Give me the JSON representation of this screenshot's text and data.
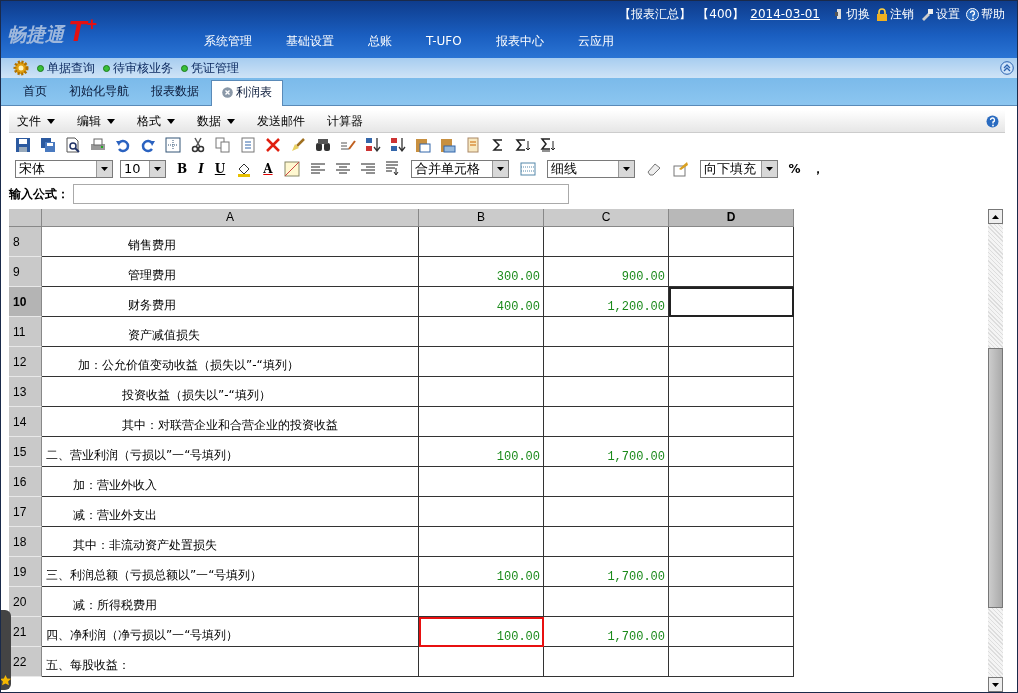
{
  "header": {
    "logo": "畅捷通",
    "logo_mark": "T",
    "logo_plus": "+",
    "status": [
      "【报表汇总】",
      "【400】"
    ],
    "date": "2014-03-01",
    "actions": [
      {
        "label": "切换",
        "kind": "switch"
      },
      {
        "label": "注销",
        "kind": "lock"
      },
      {
        "label": "设置",
        "kind": "settings"
      },
      {
        "label": "帮助",
        "kind": "help"
      }
    ],
    "nav": [
      "系统管理",
      "基础设置",
      "总账",
      "T-UFO",
      "报表中心",
      "云应用"
    ]
  },
  "quickbar": [
    "单据查询",
    "待审核业务",
    "凭证管理"
  ],
  "tabs": [
    {
      "label": "首页",
      "selected": false,
      "closable": false
    },
    {
      "label": "初始化导航",
      "selected": false,
      "closable": false
    },
    {
      "label": "报表数据",
      "selected": false,
      "closable": false
    },
    {
      "label": "利润表",
      "selected": true,
      "closable": true
    }
  ],
  "menu": [
    {
      "label": "文件",
      "dropdown": true
    },
    {
      "label": "编辑",
      "dropdown": true
    },
    {
      "label": "格式",
      "dropdown": true
    },
    {
      "label": "数据",
      "dropdown": true
    },
    {
      "label": "发送邮件",
      "dropdown": false
    },
    {
      "label": "计算器",
      "dropdown": false
    }
  ],
  "format_bar": {
    "font": "宋体",
    "size": "10",
    "bold": "B",
    "italic": "I",
    "underline": "U",
    "font_color": "A",
    "merge": "合并单元格",
    "border": "细线",
    "fill": "向下填充",
    "percent": "%",
    "comma": "，"
  },
  "formula": {
    "label": "输入公式："
  },
  "grid": {
    "columns": [
      "A",
      "B",
      "C",
      "D"
    ],
    "rows": [
      {
        "num": "8",
        "kind": "level3",
        "label": "销售费用",
        "current": false,
        "selected_d": false,
        "flagged_b": false
      },
      {
        "num": "9",
        "kind": "level3",
        "label": "管理费用",
        "b": "300.00",
        "c": "900.00",
        "current": false,
        "selected_d": false,
        "flagged_b": false
      },
      {
        "num": "10",
        "kind": "level3",
        "label": "财务费用",
        "b": "400.00",
        "c": "1,200.00",
        "current": true,
        "selected_d": true,
        "flagged_b": false
      },
      {
        "num": "11",
        "kind": "level3",
        "label": "资产减值损失",
        "current": false,
        "selected_d": false,
        "flagged_b": false
      },
      {
        "num": "12",
        "kind": "level2",
        "label": "加：公允价值变动收益（损失以”-“填列）",
        "current": false,
        "selected_d": false,
        "flagged_b": false
      },
      {
        "num": "13",
        "kind": "level3b",
        "label": "投资收益（损失以”-“填列）",
        "current": false,
        "selected_d": false,
        "flagged_b": false
      },
      {
        "num": "14",
        "kind": "level3b",
        "label": "其中：对联营企业和合营企业的投资收益",
        "current": false,
        "selected_d": false,
        "flagged_b": false
      },
      {
        "num": "15",
        "kind": "level1",
        "label": "二、营业利润（亏损以”一“号填列）",
        "b": "100.00",
        "c": "1,700.00",
        "current": false,
        "selected_d": false,
        "flagged_b": false
      },
      {
        "num": "16",
        "kind": "level2b",
        "label": "加：营业外收入",
        "current": false,
        "selected_d": false,
        "flagged_b": false
      },
      {
        "num": "17",
        "kind": "level2b",
        "label": "减：营业外支出",
        "current": false,
        "selected_d": false,
        "flagged_b": false
      },
      {
        "num": "18",
        "kind": "level2b",
        "label": "其中：非流动资产处置损失",
        "current": false,
        "selected_d": false,
        "flagged_b": false
      },
      {
        "num": "19",
        "kind": "level1",
        "label": "三、利润总额（亏损总额以”一“号填列）",
        "b": "100.00",
        "c": "1,700.00",
        "current": false,
        "selected_d": false,
        "flagged_b": false
      },
      {
        "num": "20",
        "kind": "level2b",
        "label": "减：所得税费用",
        "current": false,
        "selected_d": false,
        "flagged_b": false
      },
      {
        "num": "21",
        "kind": "level1",
        "label": "四、净利润（净亏损以”一“号填列）",
        "b": "100.00",
        "c": "1,700.00",
        "current": false,
        "selected_d": false,
        "flagged_b": true
      },
      {
        "num": "22",
        "kind": "level1",
        "label": "五、每股收益：",
        "current": false,
        "selected_d": false,
        "flagged_b": false
      }
    ]
  }
}
